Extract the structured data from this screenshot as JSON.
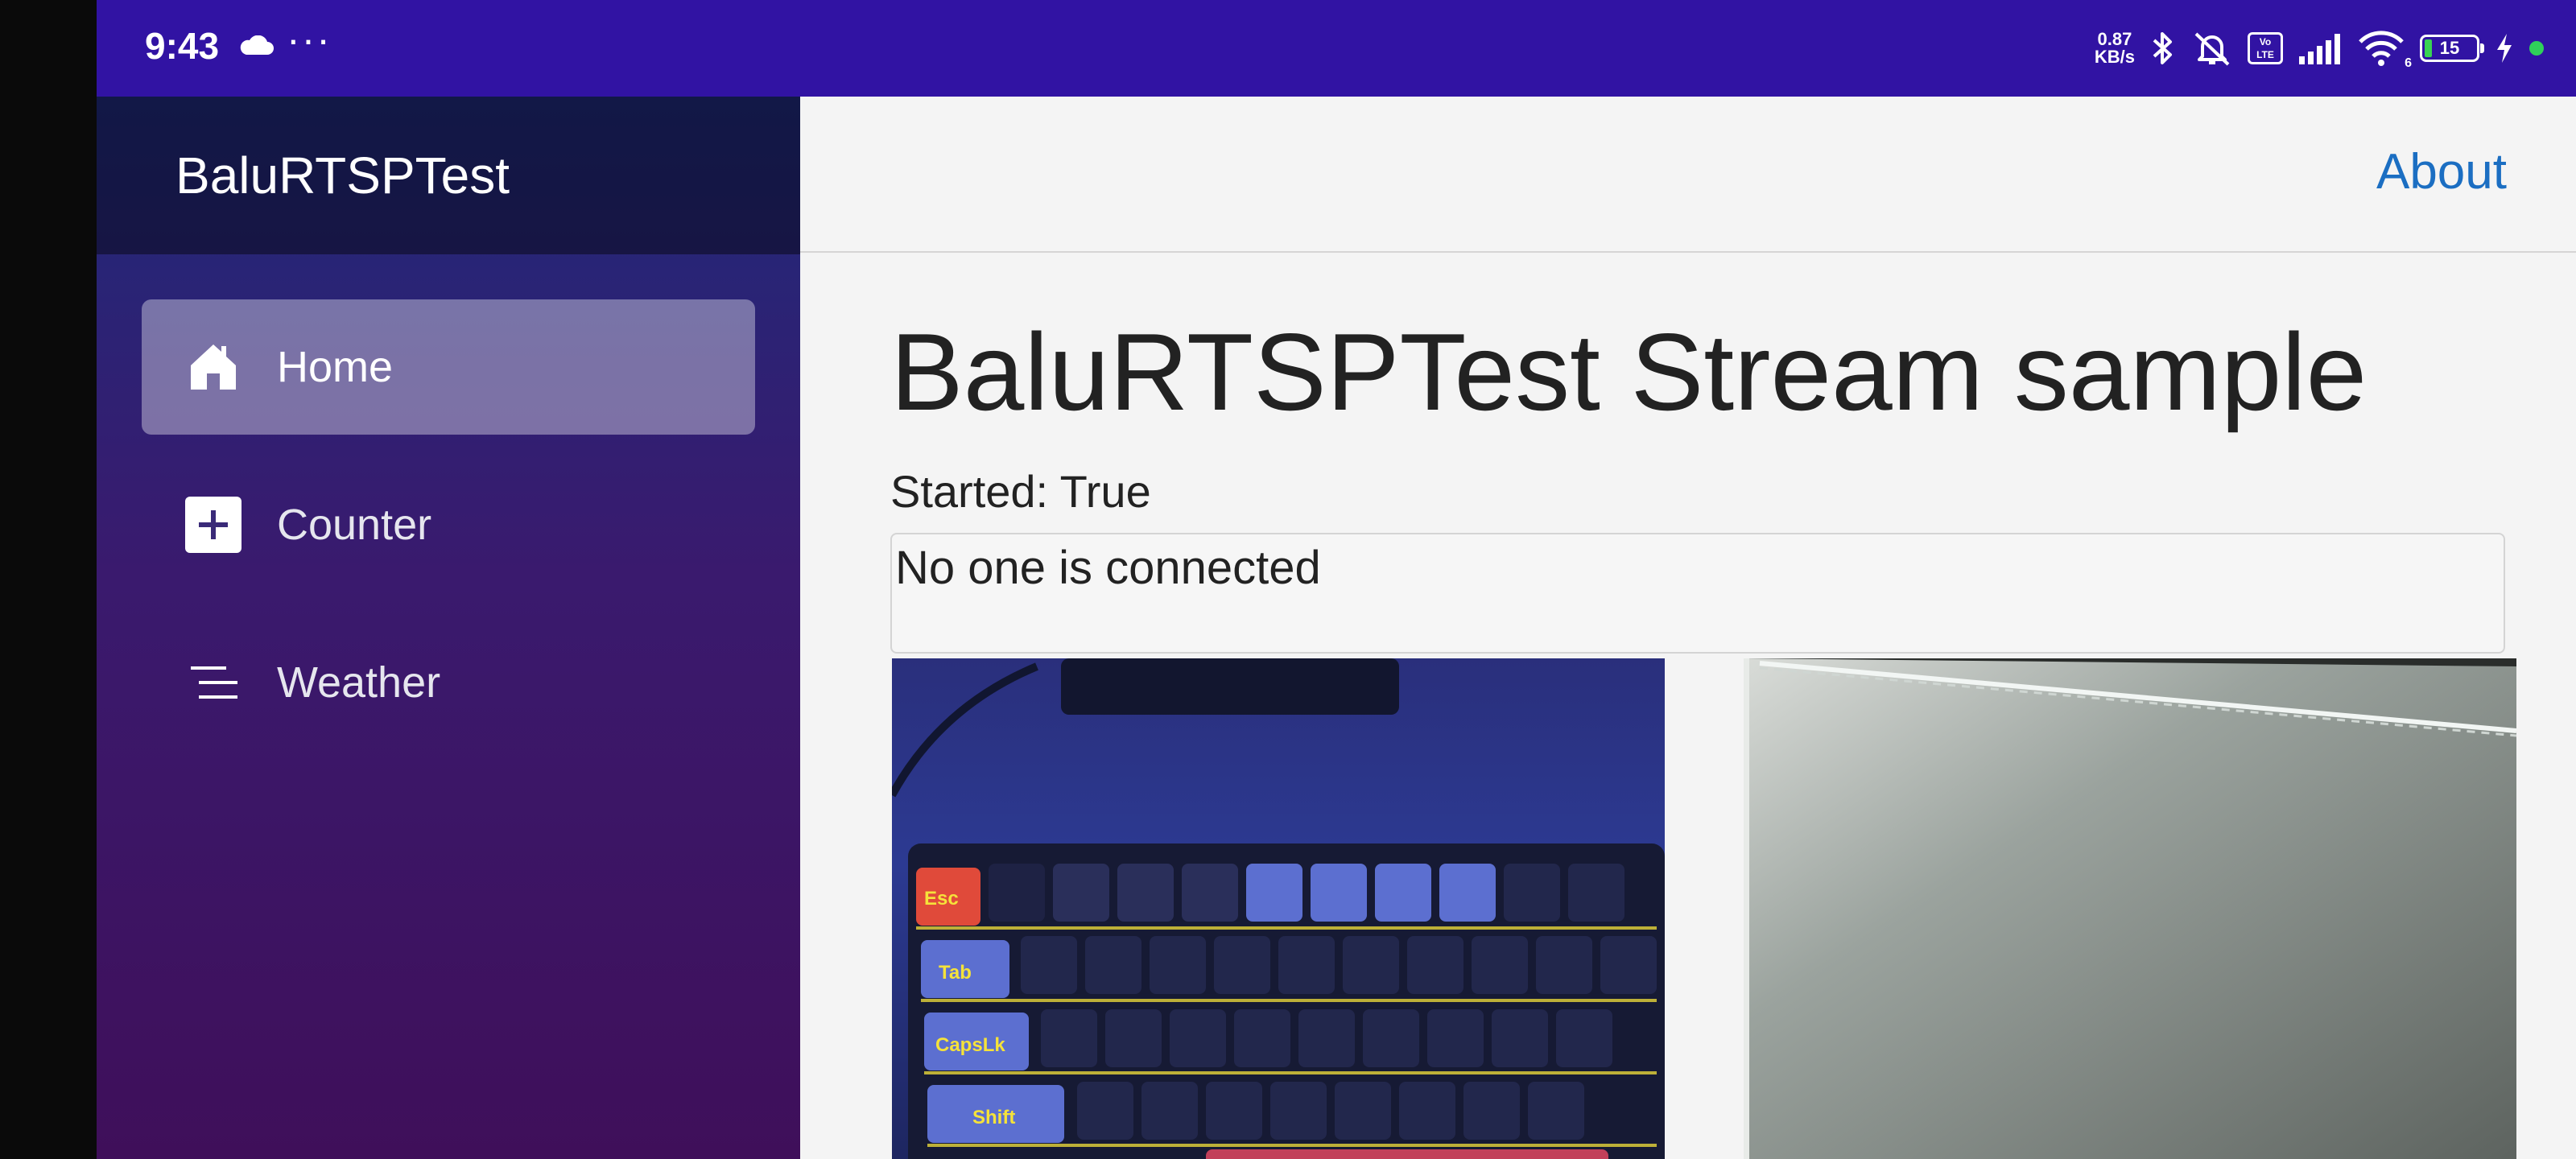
{
  "status_bar": {
    "time": "9:43",
    "dots": "···",
    "speed_value": "0.87",
    "speed_unit": "KB/s",
    "volte": "Vo LTE",
    "wifi_badge": "6",
    "battery": "15",
    "icons": [
      "cloud-icon",
      "bluetooth-icon",
      "mute-icon",
      "volte-icon",
      "signal-icon",
      "wifi-icon",
      "battery-icon",
      "charging-icon"
    ],
    "background_color": "#3113a3"
  },
  "sidebar": {
    "brand": "BaluRTSPTest",
    "items": [
      {
        "label": "Home",
        "icon": "home-icon",
        "active": true
      },
      {
        "label": "Counter",
        "icon": "plus-icon",
        "active": false
      },
      {
        "label": "Weather",
        "icon": "list-icon",
        "active": false
      }
    ]
  },
  "topbar": {
    "about_label": "About",
    "link_color": "#1b6ec2"
  },
  "main": {
    "title": "BaluRTSPTest Stream sample",
    "started": "Started: True",
    "connection_status": "No one is connected",
    "videos": [
      {
        "name": "keyboard camera feed",
        "keys": [
          "Esc",
          "Tab",
          "CapsLk",
          "Shift"
        ]
      },
      {
        "name": "wall camera feed"
      }
    ]
  }
}
